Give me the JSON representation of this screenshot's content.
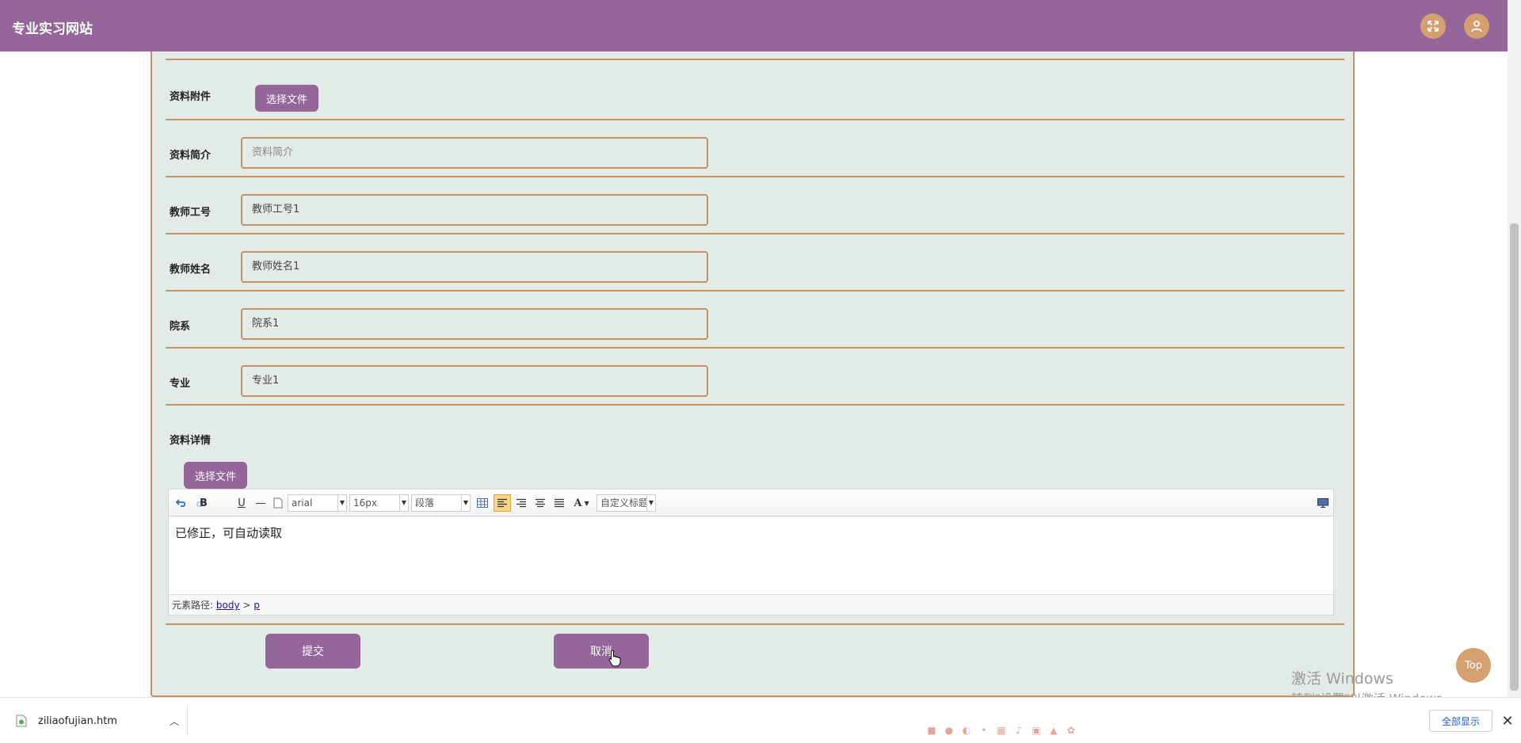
{
  "header": {
    "title": "专业实习网站"
  },
  "form": {
    "attachment": {
      "label": "资料附件",
      "button": "选择文件"
    },
    "summary": {
      "label": "资料简介",
      "placeholder": "资料简介",
      "value": ""
    },
    "teacher_id": {
      "label": "教师工号",
      "value": "教师工号1"
    },
    "teacher_name": {
      "label": "教师姓名",
      "value": "教师姓名1"
    },
    "department": {
      "label": "院系",
      "value": "院系1"
    },
    "major": {
      "label": "专业",
      "value": "专业1"
    },
    "details": {
      "label": "资料详情",
      "button": "选择文件",
      "toolbar": {
        "bold": "B",
        "underline": "U",
        "hr": "—",
        "font_family": "arial",
        "font_size": "16px",
        "paragraph": "段落",
        "font_color": "A",
        "custom_title": "自定义标题"
      },
      "content": "已修正，可自动读取",
      "path_label": "元素路径:",
      "path_body": "body",
      "path_sep": ">",
      "path_p": "p"
    },
    "submit": "提交",
    "cancel": "取消"
  },
  "top_button": "Top",
  "watermark": {
    "line1": "激活 Windows",
    "line2": "转到\"设置\"以激活 Windows。"
  },
  "downloads": {
    "file_name": "ziliaofujian.htm",
    "show_all": "全部显示",
    "close": "✕"
  },
  "colors": {
    "accent": "#946699",
    "border": "#c79065",
    "panel": "#e2ebe5",
    "orange": "#d4a06f"
  }
}
